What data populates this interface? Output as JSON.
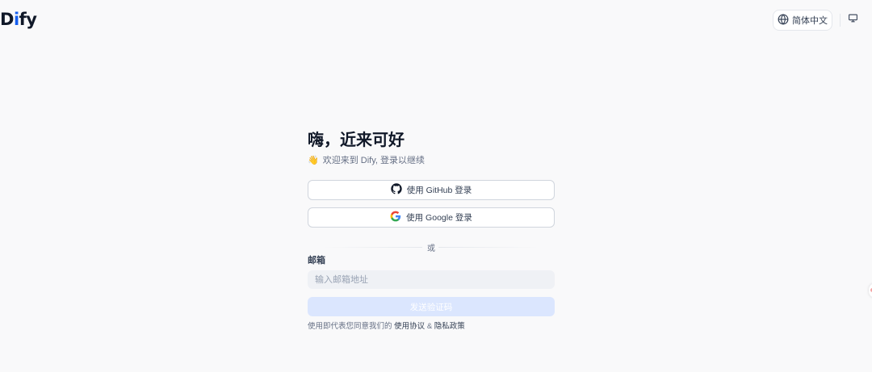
{
  "header": {
    "logo_prefix": "D",
    "logo_accent": "i",
    "logo_suffix": "fy",
    "language_label": "简体中文",
    "icons": {
      "language": "globe-icon",
      "theme": "monitor-icon"
    }
  },
  "login": {
    "title": "嗨，近来可好",
    "wave_emoji": "👋",
    "subtitle": "欢迎来到 Dify, 登录以继续",
    "github_label": "使用 GitHub 登录",
    "google_label": "使用 Google 登录",
    "divider_text": "或",
    "email_label": "邮箱",
    "email_placeholder": "输入邮箱地址",
    "email_value": "",
    "send_code_label": "发送验证码",
    "terms_prefix": "使用即代表您同意我们的",
    "terms_link": "使用协议",
    "terms_and": "&",
    "privacy_link": "隐私政策"
  },
  "colors": {
    "accent": "#155eef",
    "background": "#f9f9fa",
    "disabled_button": "#dbe6fe"
  }
}
